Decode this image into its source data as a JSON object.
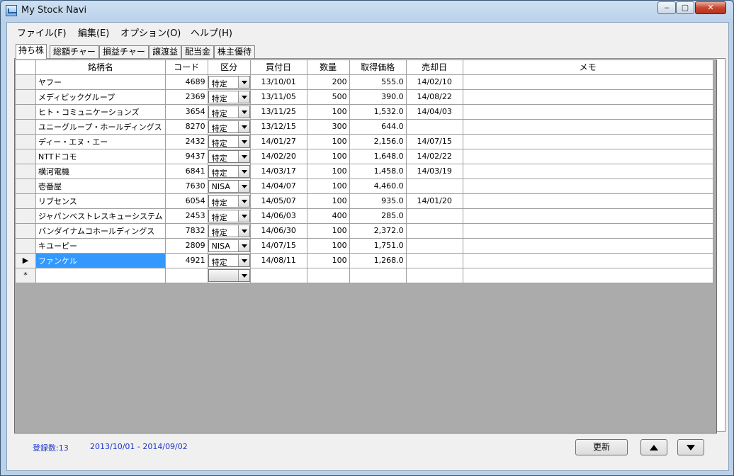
{
  "window": {
    "title": "My Stock Navi",
    "min": "‒",
    "max": "▢",
    "close": "✕"
  },
  "menu": [
    "ファイル(F)",
    "編集(E)",
    "オプション(O)",
    "ヘルプ(H)"
  ],
  "tabs": [
    "持ち株",
    "総額チャート",
    "損益チャート",
    "譲渡益",
    "配当金",
    "株主優待"
  ],
  "grid": {
    "columns": [
      "銘柄名",
      "コード",
      "区分",
      "買付日",
      "数量",
      "取得価格",
      "売却日",
      "メモ"
    ],
    "rows": [
      {
        "name": "ヤフー",
        "code": "4689",
        "kubun": "特定",
        "buy": "13/10/01",
        "qty": "200",
        "price": "555.0",
        "sell": "14/02/10",
        "memo": ""
      },
      {
        "name": "メディピックグループ",
        "code": "2369",
        "kubun": "特定",
        "buy": "13/11/05",
        "qty": "500",
        "price": "390.0",
        "sell": "14/08/22",
        "memo": ""
      },
      {
        "name": "ヒト・コミュニケーションズ",
        "code": "3654",
        "kubun": "特定",
        "buy": "13/11/25",
        "qty": "100",
        "price": "1,532.0",
        "sell": "14/04/03",
        "memo": ""
      },
      {
        "name": "ユニーグループ・ホールディングス",
        "code": "8270",
        "kubun": "特定",
        "buy": "13/12/15",
        "qty": "300",
        "price": "644.0",
        "sell": "",
        "memo": ""
      },
      {
        "name": "ディー・エヌ・エー",
        "code": "2432",
        "kubun": "特定",
        "buy": "14/01/27",
        "qty": "100",
        "price": "2,156.0",
        "sell": "14/07/15",
        "memo": ""
      },
      {
        "name": "NTTドコモ",
        "code": "9437",
        "kubun": "特定",
        "buy": "14/02/20",
        "qty": "100",
        "price": "1,648.0",
        "sell": "14/02/22",
        "memo": ""
      },
      {
        "name": "横河電機",
        "code": "6841",
        "kubun": "特定",
        "buy": "14/03/17",
        "qty": "100",
        "price": "1,458.0",
        "sell": "14/03/19",
        "memo": ""
      },
      {
        "name": "壱番屋",
        "code": "7630",
        "kubun": "NISA",
        "buy": "14/04/07",
        "qty": "100",
        "price": "4,460.0",
        "sell": "",
        "memo": ""
      },
      {
        "name": "リブセンス",
        "code": "6054",
        "kubun": "特定",
        "buy": "14/05/07",
        "qty": "100",
        "price": "935.0",
        "sell": "14/01/20",
        "memo": ""
      },
      {
        "name": "ジャパンベストレスキューシステム",
        "code": "2453",
        "kubun": "特定",
        "buy": "14/06/03",
        "qty": "400",
        "price": "285.0",
        "sell": "",
        "memo": ""
      },
      {
        "name": "バンダイナムコホールディングス",
        "code": "7832",
        "kubun": "特定",
        "buy": "14/06/30",
        "qty": "100",
        "price": "2,372.0",
        "sell": "",
        "memo": ""
      },
      {
        "name": "キユーピー",
        "code": "2809",
        "kubun": "NISA",
        "buy": "14/07/15",
        "qty": "100",
        "price": "1,751.0",
        "sell": "",
        "memo": ""
      },
      {
        "name": "ファンケル",
        "code": "4921",
        "kubun": "特定",
        "buy": "14/08/11",
        "qty": "100",
        "price": "1,268.0",
        "sell": "",
        "memo": "",
        "current": true
      }
    ],
    "new_row_marker": "*",
    "current_row_marker": "▶"
  },
  "status": {
    "count_label": "登録数:",
    "count": "13",
    "range": "2013/10/01 - 2014/09/02"
  },
  "buttons": {
    "refresh": "更新",
    "up_icon": "up-triangle-icon",
    "down_icon": "down-triangle-icon"
  },
  "colors": {
    "selection": "#3399ff",
    "status_text": "#1b34c8",
    "grid_background": "#ababab"
  }
}
